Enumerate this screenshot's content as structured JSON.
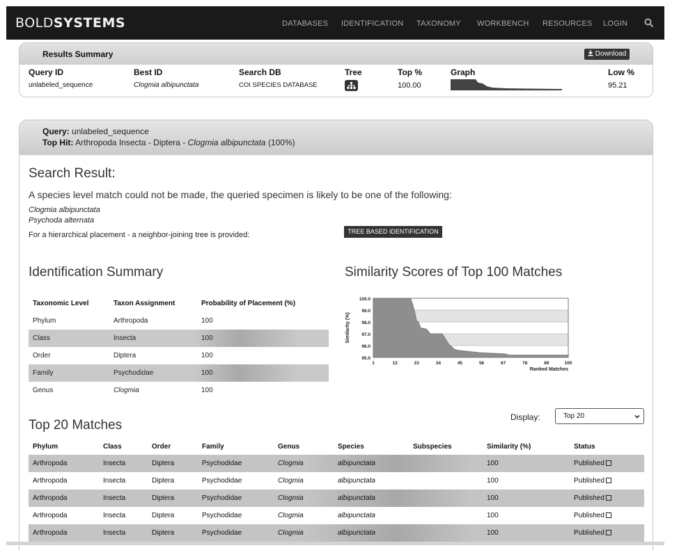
{
  "navbar": {
    "brand_a": "BOLD",
    "brand_b": "SYSTEMS",
    "items": [
      "DATABASES",
      "IDENTIFICATION",
      "TAXONOMY",
      "WORKBENCH",
      "RESOURCES",
      "LOGIN"
    ]
  },
  "results_summary": {
    "title": "Results Summary",
    "download_label": "Download",
    "headers": [
      "Query ID",
      "Best ID",
      "Search DB",
      "Tree",
      "Top %",
      "Graph",
      "Low %"
    ],
    "query_id": "unlabeled_sequence",
    "best_id": "Clogmia albipunctata",
    "search_db": "COI SPECIES DATABASE",
    "top_pct": "100.00",
    "low_pct": "95.21"
  },
  "query": {
    "query_label": "Query:",
    "query_value": "unlabeled_sequence",
    "tophit_label": "Top Hit:",
    "tophit_value": "Arthropoda Insecta - Diptera -",
    "tophit_species": "Clogmia albipunctata",
    "tophit_pct": "(100%)"
  },
  "search_result": {
    "heading": "Search Result:",
    "text": "A species level match could not be made, the queried specimen is likely to be one of the following:",
    "species": [
      "Clogmia albipunctata",
      "Psychoda alternata"
    ],
    "hierarchy_text": "For a hierarchical placement - a neighbor-joining tree is provided:",
    "tree_button": "TREE BASED IDENTIFICATION"
  },
  "identification_summary": {
    "heading": "Identification Summary",
    "headers": [
      "Taxonomic Level",
      "Taxon Assignment",
      "Probability of Placement (%)"
    ],
    "rows": [
      {
        "level": "Phylum",
        "taxon": "Arthropoda",
        "prob": "100"
      },
      {
        "level": "Class",
        "taxon": "Insecta",
        "prob": "100"
      },
      {
        "level": "Order",
        "taxon": "Diptera",
        "prob": "100"
      },
      {
        "level": "Family",
        "taxon": "Psychodidae",
        "prob": "100"
      },
      {
        "level": "Genus",
        "taxon": "Clogmia",
        "prob": "100"
      }
    ]
  },
  "similarity": {
    "heading": "Similarity Scores of Top 100 Matches"
  },
  "chart_data": {
    "type": "area",
    "ylabel": "Similarity (%)",
    "xlabel": "Ranked Matches",
    "ylim": [
      95.0,
      100.0
    ],
    "xlim": [
      1,
      100
    ],
    "y_ticks": [
      "100.0",
      "99.0",
      "98.0",
      "97.0",
      "96.0",
      "95.0"
    ],
    "x_ticks": [
      "1",
      "12",
      "23",
      "34",
      "45",
      "56",
      "67",
      "78",
      "89",
      "100"
    ],
    "x": [
      1,
      20,
      21,
      22,
      23,
      24,
      25,
      28,
      30,
      36,
      38,
      39,
      40,
      41,
      42,
      44,
      50,
      55,
      68,
      70,
      100
    ],
    "y": [
      100.0,
      100.0,
      99.5,
      98.9,
      98.1,
      98.0,
      97.5,
      97.4,
      97.0,
      97.0,
      96.5,
      96.2,
      96.0,
      95.9,
      95.7,
      95.6,
      95.5,
      95.4,
      95.3,
      95.2,
      95.2
    ],
    "grid": true
  },
  "matches": {
    "heading": "Top 20 Matches",
    "display_label": "Display:",
    "display_value": "Top 20",
    "headers": [
      "Phylum",
      "Class",
      "Order",
      "Family",
      "Genus",
      "Species",
      "Subspecies",
      "Similarity (%)",
      "Status"
    ],
    "rows": [
      {
        "phylum": "Arthropoda",
        "class": "Insecta",
        "order": "Diptera",
        "family": "Psychodidae",
        "genus": "Clogmia",
        "species": "albipunctata",
        "subspecies": "",
        "similarity": "100",
        "status": "Published"
      },
      {
        "phylum": "Arthropoda",
        "class": "Insecta",
        "order": "Diptera",
        "family": "Psychodidae",
        "genus": "Clogmia",
        "species": "albipunctata",
        "subspecies": "",
        "similarity": "100",
        "status": "Published"
      },
      {
        "phylum": "Arthropoda",
        "class": "Insecta",
        "order": "Diptera",
        "family": "Psychodidae",
        "genus": "Clogmia",
        "species": "albipunctata",
        "subspecies": "",
        "similarity": "100",
        "status": "Published"
      },
      {
        "phylum": "Arthropoda",
        "class": "Insecta",
        "order": "Diptera",
        "family": "Psychodidae",
        "genus": "Clogmia",
        "species": "albipunctata",
        "subspecies": "",
        "similarity": "100",
        "status": "Published"
      },
      {
        "phylum": "Arthropoda",
        "class": "Insecta",
        "order": "Diptera",
        "family": "Psychodidae",
        "genus": "Clogmia",
        "species": "albipunctata",
        "subspecies": "",
        "similarity": "100",
        "status": "Published"
      }
    ]
  }
}
